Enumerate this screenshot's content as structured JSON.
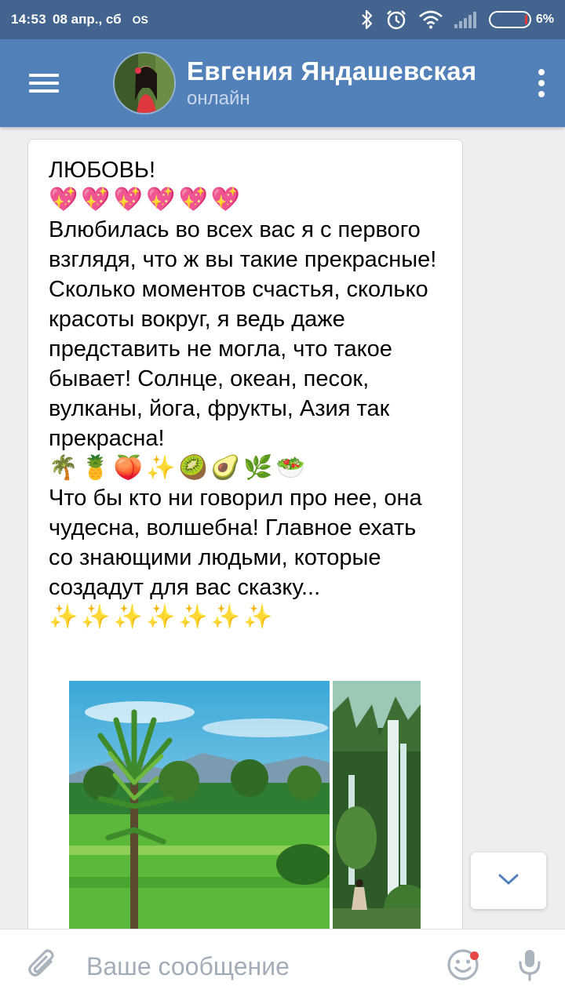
{
  "status_bar": {
    "time": "14:53",
    "date": "08 апр., сб",
    "os_label": "OS",
    "battery": "6%"
  },
  "header": {
    "contact_name": "Евгения Яндашевская",
    "contact_status": "онлайн"
  },
  "message": {
    "heading": "ЛЮБОВЬ!",
    "paragraph_1": "Влюбилась во всех вас я с первого взглядя, что ж вы такие прекрасные! Сколько моментов счастья, сколько красоты вокруг, я ведь даже представить не могла, что такое бывает! Солнце, океан, песок, вулканы, йога, фрукты, Азия так прекрасна!",
    "paragraph_2": "Что бы кто ни говорил про нее, она чудесна, волшебна! Главное ехать со знающими людьми, которые создадут для вас сказку...",
    "hearts": [
      "💖",
      "💖",
      "💖",
      "💖",
      "💖",
      "💖"
    ],
    "tropical_emoji": [
      "🌴",
      "🍍",
      "🍑",
      "✨",
      "🥝",
      "🥑",
      "🌿",
      "🥗"
    ],
    "sparkles": [
      "✨",
      "✨",
      "✨",
      "✨",
      "✨",
      "✨",
      "✨"
    ]
  },
  "composer": {
    "placeholder": "Ваше сообщение"
  },
  "colors": {
    "status_bar": "#43648e",
    "header": "#5181b8",
    "background": "#edeef0",
    "placeholder": "#a3adb8",
    "icon_gray": "#aab4bf",
    "accent_blue": "#5181b8"
  },
  "icons": [
    "menu-icon",
    "more-icon",
    "bluetooth-icon",
    "alarm-icon",
    "wifi-icon",
    "signal-icon",
    "battery-icon",
    "chevron-down-icon",
    "paperclip-icon",
    "smile-icon",
    "microphone-icon"
  ]
}
